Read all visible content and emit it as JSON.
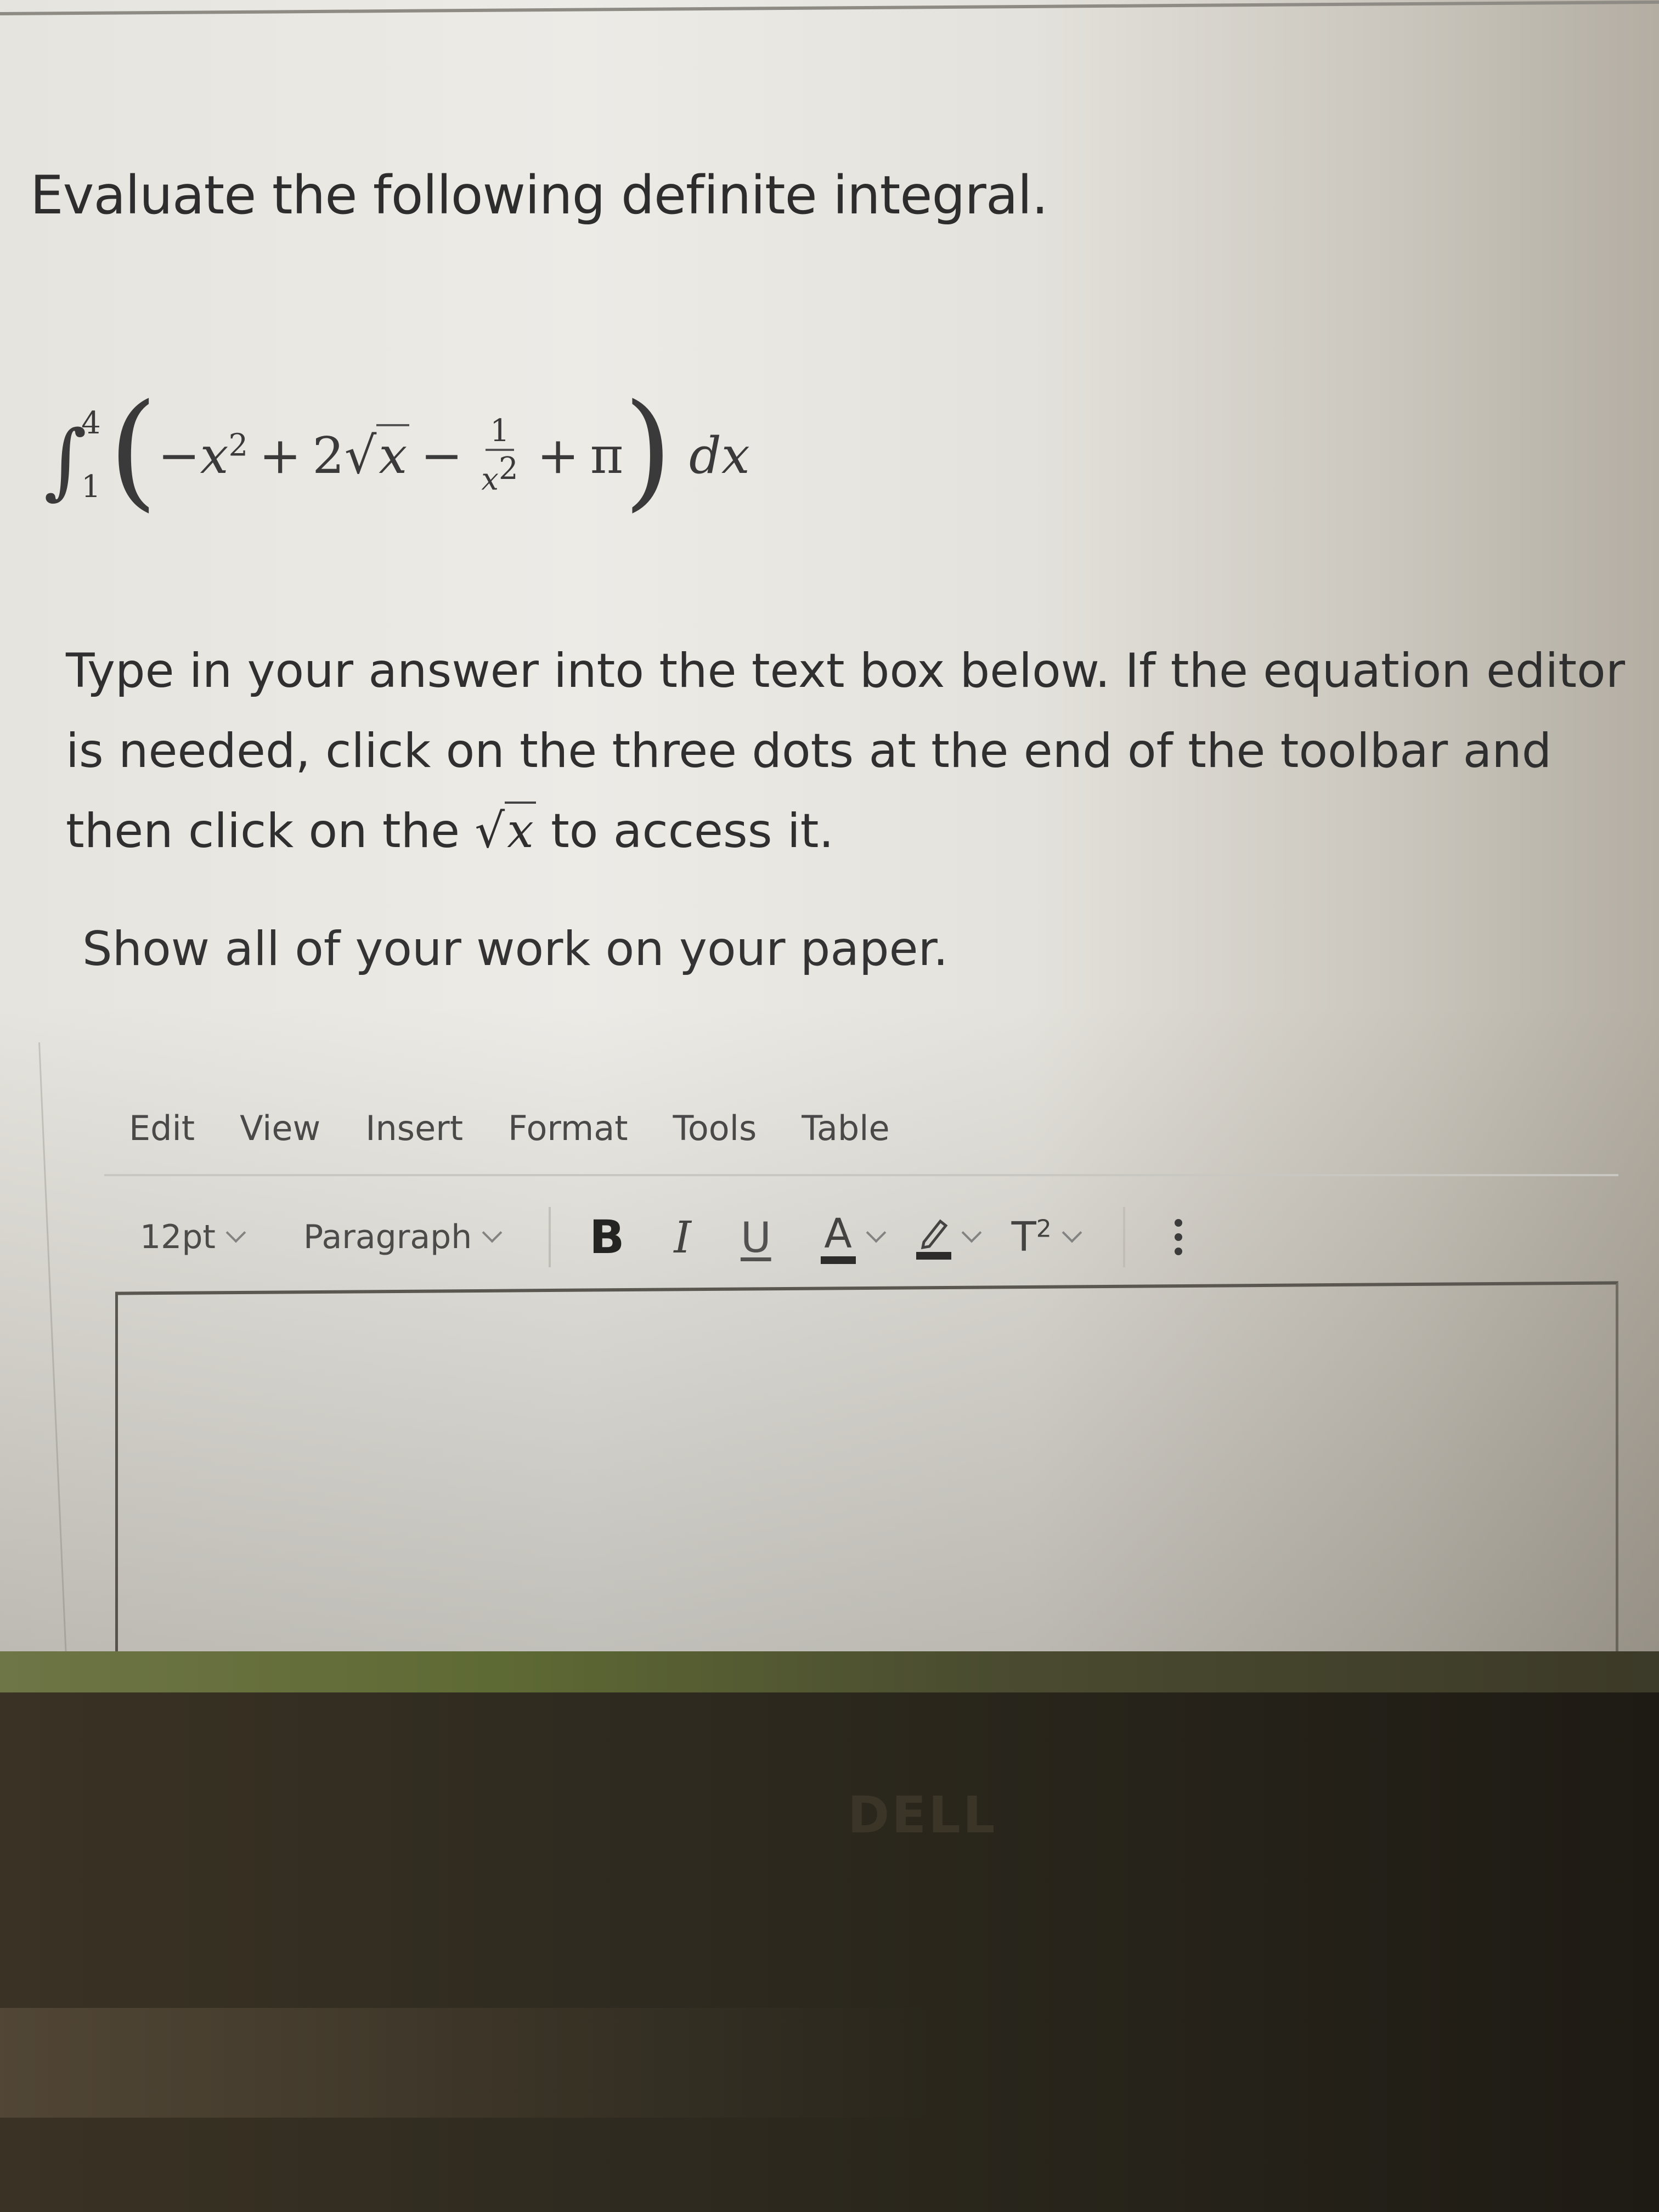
{
  "question": {
    "title": "Evaluate the following definite integral.",
    "integral": {
      "sign": "∫",
      "lower_limit": "1",
      "upper_limit": "4",
      "open_paren": "(",
      "close_paren": ")",
      "term1": "−x",
      "term1_exp": "2",
      "op1": "+",
      "term2_coef": "2",
      "sqrt_symbol": "√",
      "term2_radicand": "x",
      "op2": "−",
      "term3_num": "1",
      "term3_den": "x",
      "term3_den_exp": "2",
      "op3": "+",
      "term4": "π",
      "differential": "dx"
    },
    "instructions_part1": "Type in your answer into the text box below. If the equation editor is needed, click on the three dots at the end of the toolbar and then click on the ",
    "instructions_sqrt_symbol": "√",
    "instructions_sqrt_var": "x",
    "instructions_part2": " to access it.",
    "show_work": "Show all of your work on your paper."
  },
  "editor": {
    "menubar": [
      "Edit",
      "View",
      "Insert",
      "Format",
      "Tools",
      "Table"
    ],
    "toolbar": {
      "font_size": "12pt",
      "block_format": "Paragraph",
      "bold": "B",
      "italic": "I",
      "underline": "U",
      "text_color": "A",
      "superscript_base": "T",
      "superscript_exp": "2",
      "icons": {
        "font_size_dropdown": "chevron-down-icon",
        "block_dropdown": "chevron-down-icon",
        "text_color": "text-color-icon",
        "highlight": "highlighter-pen-icon",
        "superscript": "superscript-icon",
        "more": "vertical-ellipsis-icon"
      }
    },
    "answer_value": ""
  },
  "device": {
    "brand_logo": "DELL"
  }
}
